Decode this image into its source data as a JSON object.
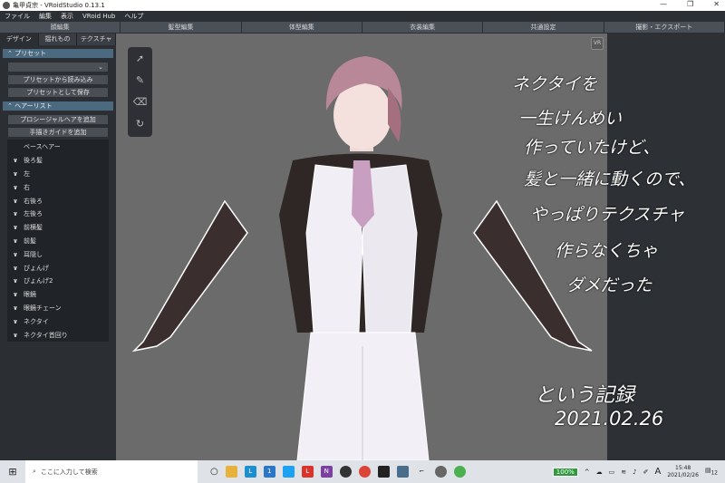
{
  "window": {
    "title": "亀甲貞宗 - VRoidStudio 0.13.1",
    "minimize": "—",
    "maximize": "❐",
    "close": "✕"
  },
  "menu": [
    "ファイル",
    "編集",
    "表示",
    "VRoid Hub",
    "ヘルプ"
  ],
  "mode_tabs": [
    "顔編集",
    "髪型編集",
    "体型編集",
    "衣装編集",
    "共通設定",
    "撮影・エクスポート"
  ],
  "sub_tabs": [
    "デザイン",
    "揺れもの",
    "テクスチャ"
  ],
  "preset": {
    "header": "プリセット",
    "dropdown_value": "",
    "load": "プリセットから読み込み",
    "save": "プリセットとして保存"
  },
  "hairlist": {
    "header": "ヘアーリスト",
    "add_procedural": "プロシージャルヘアを追加",
    "add_guide": "手描きガイドを追加",
    "items": [
      "ベースヘアー",
      "後ろ髪",
      "左",
      "右",
      "右後ろ",
      "左後ろ",
      "前横髪",
      "前髪",
      "耳隠し",
      "ぴょんげ",
      "ぴょんげ2",
      "眼鏡",
      "眼鏡チェーン",
      "ネクタイ",
      "ネクタイ首回り"
    ]
  },
  "viewport": {
    "vr_label": "VR"
  },
  "annotation": {
    "lines": [
      "ネクタイを",
      "一生けんめい",
      "作っていたけど、",
      "髪と一緒に動くので、",
      "やっぱりテクスチャ",
      "作らなくちゃ",
      "ダメだった"
    ],
    "footer": "という記録",
    "date": "2021.02.26"
  },
  "taskbar": {
    "search_placeholder": "ここに入力して検索",
    "battery": "100%",
    "ime": "A",
    "time": "15:48",
    "date": "2021/02/26",
    "notifications": "12",
    "mail_badge": "1"
  }
}
